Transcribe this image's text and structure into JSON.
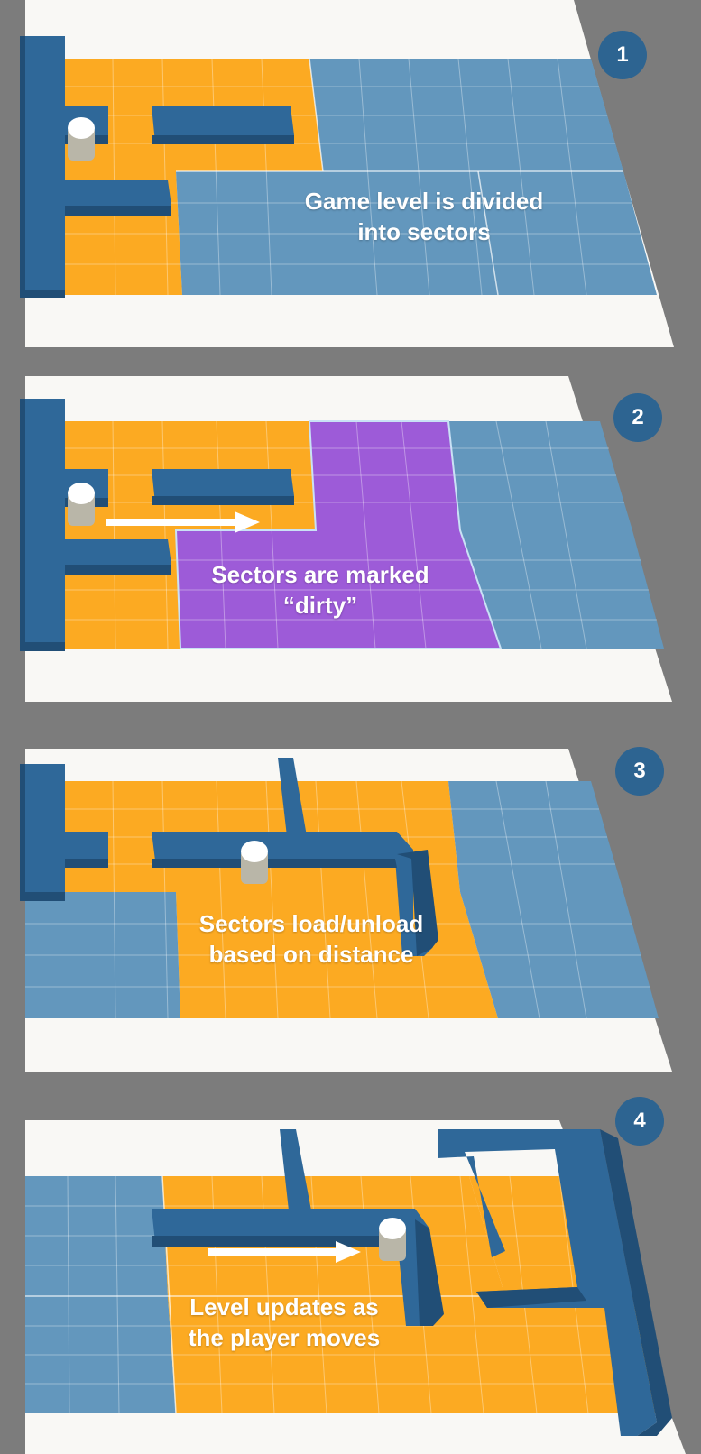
{
  "colors": {
    "background": "#7c7c7c",
    "floor": "#f9f8f5",
    "loaded_sector": "#fcaa22",
    "unloaded_sector": "#6397bd",
    "dirty_sector": "#9d5bd8",
    "wall_top": "#2f6899",
    "wall_side": "#214e76",
    "badge": "#2d6491",
    "caption": "#ffffff"
  },
  "panels": [
    {
      "number": "1",
      "caption": [
        "Game level is divided",
        "into sectors"
      ]
    },
    {
      "number": "2",
      "caption": [
        "Sectors are marked",
        "“dirty”"
      ]
    },
    {
      "number": "3",
      "caption": [
        "Sectors load/unload",
        "based on distance"
      ]
    },
    {
      "number": "4",
      "caption": [
        "Level updates as",
        "the player moves"
      ]
    }
  ]
}
